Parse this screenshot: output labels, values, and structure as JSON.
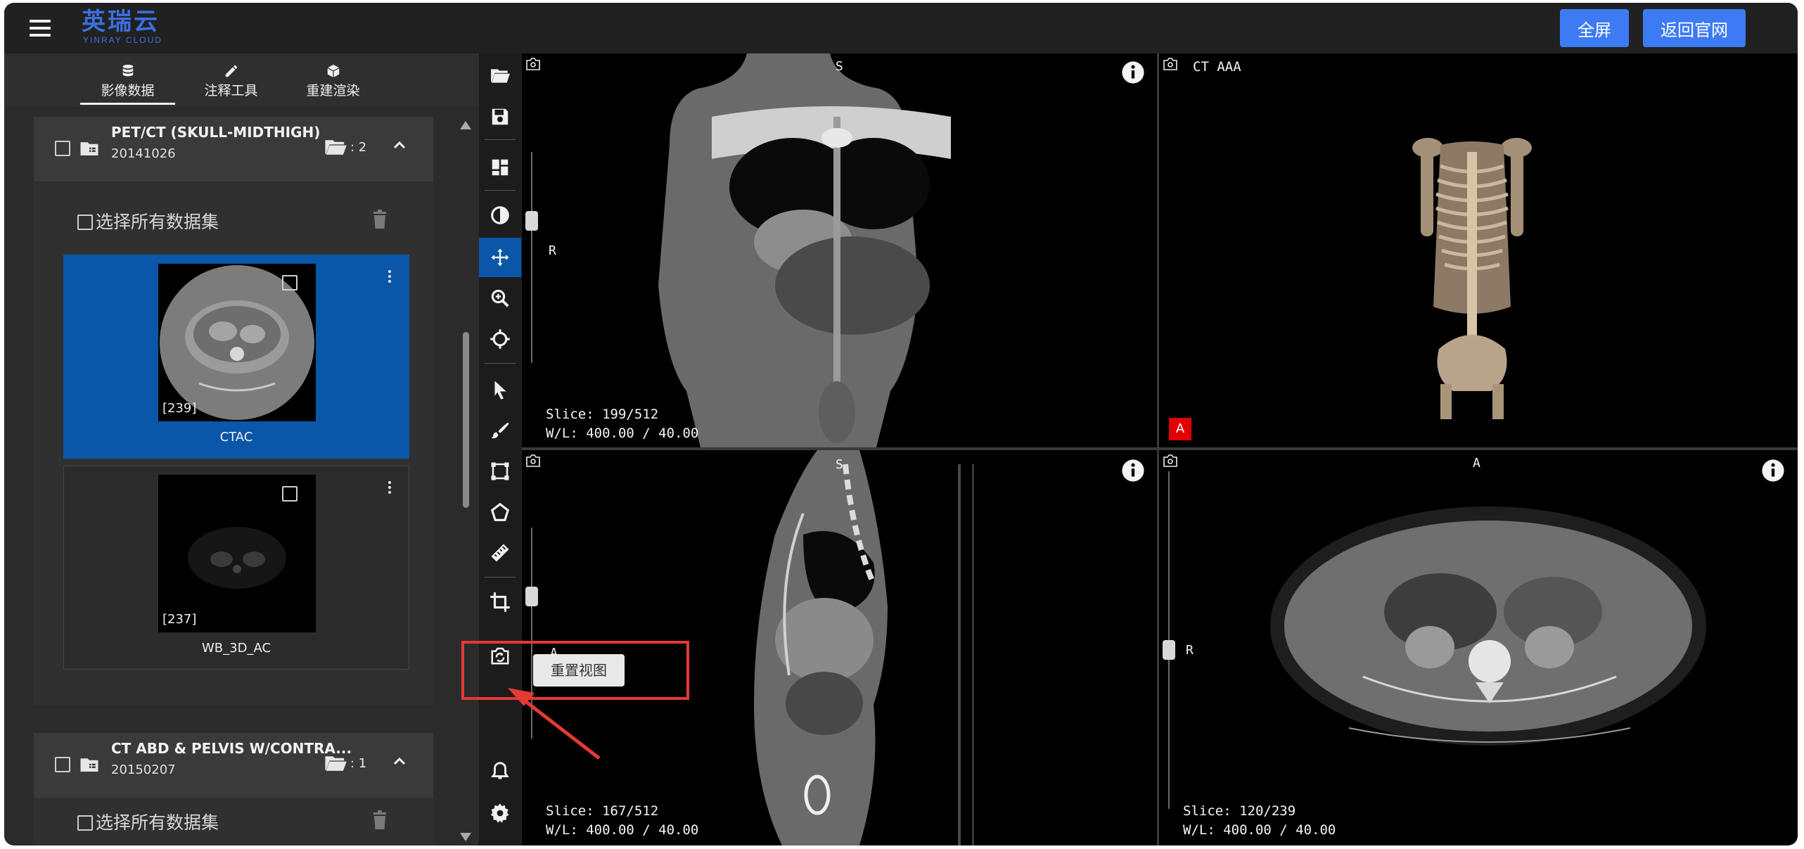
{
  "header": {
    "logo_cn": "英瑞云",
    "logo_en": "YINRAY CLOUD",
    "fullscreen_label": "全屏",
    "home_label": "返回官网"
  },
  "tabs": [
    {
      "label": "影像数据",
      "icon": "database-icon"
    },
    {
      "label": "注释工具",
      "icon": "pencil-icon"
    },
    {
      "label": "重建渲染",
      "icon": "cube-icon"
    }
  ],
  "studies": [
    {
      "name": "PET/CT (SKULL-MIDTHIGH)",
      "date": "20141026",
      "count": ": 2",
      "select_all": "选择所有数据集",
      "series": [
        {
          "label": "CTAC",
          "count": "[239]",
          "selected": true
        },
        {
          "label": "WB_3D_AC",
          "count": "[237]",
          "selected": false
        }
      ]
    },
    {
      "name": "CT ABD & PELVIS W/CONTRA...",
      "date": "20150207",
      "count": ": 1",
      "select_all": "选择所有数据集"
    }
  ],
  "toolbar": {
    "tools": [
      "open-folder-icon",
      "save-icon",
      "layout-icon",
      "contrast-icon",
      "pan-icon",
      "zoom-icon",
      "crosshair-icon",
      "pointer-icon",
      "brush-icon",
      "rectangle-roi-icon",
      "polygon-icon",
      "ruler-icon",
      "crop-icon",
      "reset-view-icon",
      "bell-icon",
      "gear-icon"
    ],
    "active": "pan-icon",
    "tooltip": "重置视图"
  },
  "viewports": {
    "coronal": {
      "slice": "Slice: 199/512",
      "wl": "W/L: 400.00 / 40.00",
      "top": "S",
      "left": "R"
    },
    "volume": {
      "desc": "CT AAA",
      "marker": "A"
    },
    "sagittal": {
      "slice": "Slice: 167/512",
      "wl": "W/L: 400.00 / 40.00",
      "top": "S",
      "left": "A"
    },
    "axial": {
      "slice": "Slice: 120/239",
      "wl": "W/L: 400.00 / 40.00",
      "top": "A",
      "left": "R"
    }
  },
  "colors": {
    "accent": "#3d7bf5",
    "selected": "#0a56a8",
    "annotation": "#e53935"
  }
}
